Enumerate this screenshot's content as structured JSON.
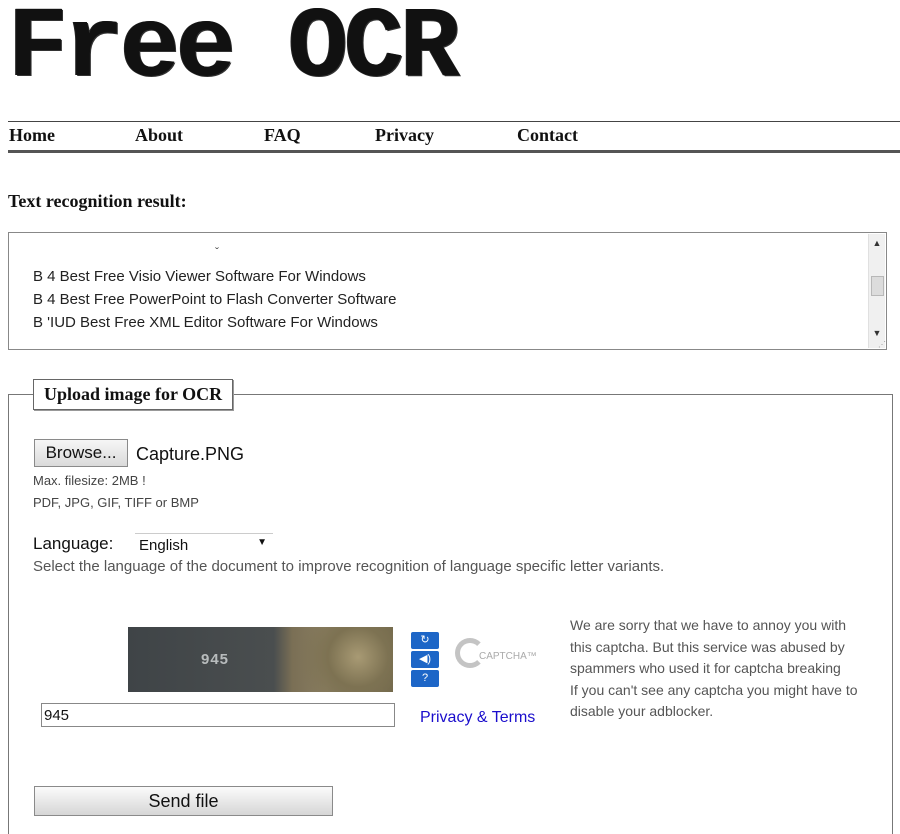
{
  "logo": {
    "text": "Free OCR"
  },
  "nav": {
    "items": [
      "Home",
      "About",
      "FAQ",
      "Privacy",
      "Contact"
    ]
  },
  "result": {
    "title": "Text recognition result:",
    "caret": "ˇ",
    "lines": [
      "B 4 Best Free Visio Viewer Software For Windows",
      "B 4 Best Free PowerPoint to Flash Converter Software",
      "B 'IUD Best Free XML Editor Software For Windows"
    ]
  },
  "upload": {
    "legend": "Upload image for OCR",
    "browse_label": "Browse...",
    "file_name": "Capture.PNG",
    "max_filesize": "Max. filesize: 2MB !",
    "formats": "PDF, JPG, GIF, TIFF or BMP",
    "language_label": "Language:",
    "language_value": "English",
    "language_hint": "Select the language of the document to improve recognition of language specific letter variants."
  },
  "captcha": {
    "image_text": "945",
    "input_value": "945",
    "refresh_icon": "↻",
    "audio_icon": "◀)",
    "help_icon": "?",
    "logo_word": "CAPTCHA™",
    "privacy_terms": "Privacy & Terms",
    "sorry_text": "We are sorry that we have to annoy you with this captcha. But this service was abused by spammers who used it for captcha breaking",
    "adblock_text": "If you can't see any captcha you might have to disable your adblocker."
  },
  "send_label": "Send file"
}
